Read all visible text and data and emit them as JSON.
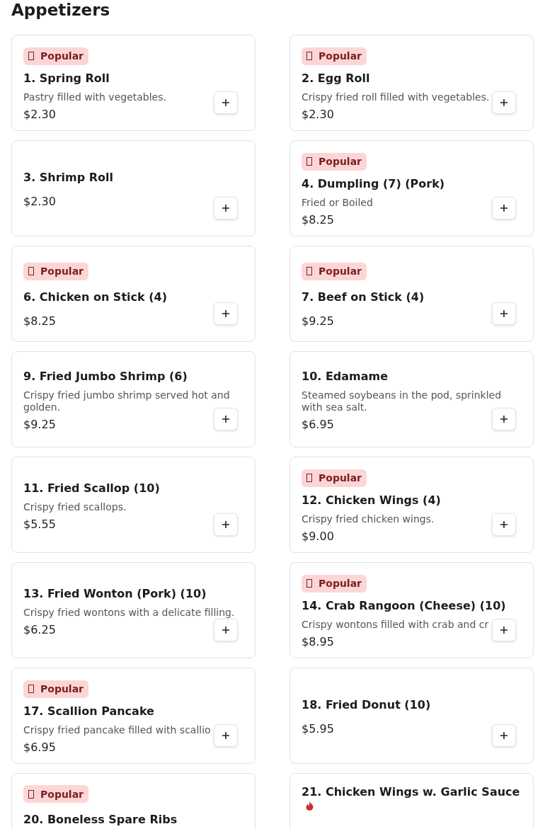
{
  "section": {
    "title": "Appetizers"
  },
  "rows": [
    {
      "items": [
        {
          "name": "1. Spring Roll",
          "badge": "Popular",
          "spicy": false,
          "description": "Pastry filled with vegetables.",
          "price": "$2.30"
        },
        {
          "name": "2. Egg Roll",
          "badge": "Popular",
          "spicy": false,
          "description": "Crispy fried roll filled with vegetables.",
          "price": "$2.30"
        }
      ]
    },
    {
      "items": [
        {
          "name": "3. Shrimp Roll",
          "spicy": false,
          "price": "$2.30"
        },
        {
          "name": "4. Dumpling (7) (Pork)",
          "badge": "Popular",
          "spicy": false,
          "description": "Fried or Boiled",
          "price": "$8.25"
        }
      ]
    },
    {
      "items": [
        {
          "name": "6. Chicken on Stick (4)",
          "badge": "Popular",
          "spicy": false,
          "price": "$8.25"
        },
        {
          "name": "7. Beef on Stick (4)",
          "badge": "Popular",
          "spicy": false,
          "price": "$9.25"
        }
      ]
    },
    {
      "items": [
        {
          "name": "9. Fried Jumbo Shrimp (6)",
          "spicy": false,
          "description": "Crispy fried jumbo shrimp served hot and golden.",
          "price": "$9.25"
        },
        {
          "name": "10. Edamame",
          "spicy": false,
          "description": "Steamed soybeans in the pod, sprinkled with sea salt.",
          "price": "$6.95"
        }
      ]
    },
    {
      "items": [
        {
          "name": "11. Fried Scallop (10)",
          "spicy": false,
          "description": "Crispy fried scallops.",
          "price": "$5.55"
        },
        {
          "name": "12. Chicken Wings (4)",
          "badge": "Popular",
          "spicy": false,
          "description": "Crispy fried chicken wings.",
          "price": "$9.00"
        }
      ]
    },
    {
      "items": [
        {
          "name": "13. Fried Wonton (Pork) (10)",
          "spicy": false,
          "description": "Crispy fried wontons with a delicate filling.",
          "price": "$6.25"
        },
        {
          "name": "14. Crab Rangoon (Cheese) (10)",
          "badge": "Popular",
          "spicy": false,
          "description": "Crispy wontons filled with crab and cr",
          "price": "$8.95"
        }
      ]
    },
    {
      "items": [
        {
          "name": "17. Scallion Pancake",
          "badge": "Popular",
          "spicy": false,
          "description": "Crispy fried pancake filled with scallio",
          "price": "$6.95"
        },
        {
          "name": "18. Fried Donut (10)",
          "spicy": false,
          "price": "$5.95"
        }
      ]
    },
    {
      "items": [
        {
          "name": "20. Boneless Spare Ribs",
          "badge": "Popular",
          "spicy": false
        },
        {
          "name": "21. Chicken Wings w. Garlic Sauce",
          "spicy": true
        }
      ]
    }
  ]
}
